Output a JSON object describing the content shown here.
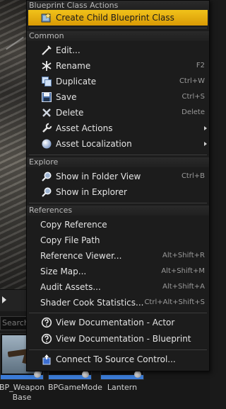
{
  "sections": [
    {
      "header": "Blueprint Class Actions",
      "items": [
        {
          "label": "Create Child Blueprint Class",
          "shortcut": "",
          "icon": "create-child-blueprint-icon",
          "highlighted": true
        }
      ]
    },
    {
      "header": "Common",
      "items": [
        {
          "label": "Edit...",
          "shortcut": "",
          "icon": "edit-icon"
        },
        {
          "label": "Rename",
          "shortcut": "F2",
          "icon": "rename-icon"
        },
        {
          "label": "Duplicate",
          "shortcut": "Ctrl+W",
          "icon": "duplicate-icon"
        },
        {
          "label": "Save",
          "shortcut": "Ctrl+S",
          "icon": "save-icon"
        },
        {
          "label": "Delete",
          "shortcut": "Delete",
          "icon": "delete-icon"
        },
        {
          "label": "Asset Actions",
          "shortcut": "",
          "icon": "wrench-icon",
          "submenu": true
        },
        {
          "label": "Asset Localization",
          "shortcut": "",
          "icon": "globe-icon",
          "submenu": true
        }
      ]
    },
    {
      "header": "Explore",
      "items": [
        {
          "label": "Show in Folder View",
          "shortcut": "Ctrl+B",
          "icon": "magnifier-icon"
        },
        {
          "label": "Show in Explorer",
          "shortcut": "",
          "icon": "magnifier-icon"
        }
      ]
    },
    {
      "header": "References",
      "items": [
        {
          "label": "Copy Reference",
          "shortcut": ""
        },
        {
          "label": "Copy File Path",
          "shortcut": ""
        },
        {
          "label": "Reference Viewer...",
          "shortcut": "Alt+Shift+R"
        },
        {
          "label": "Size Map...",
          "shortcut": "Alt+Shift+M"
        },
        {
          "label": "Audit Assets...",
          "shortcut": "Alt+Shift+A"
        },
        {
          "label": "Shader Cook Statistics...",
          "shortcut": "Ctrl+Alt+Shift+S"
        },
        {
          "label": "View Documentation - Actor",
          "shortcut": "",
          "icon": "help-icon"
        },
        {
          "label": "View Documentation - Blueprint",
          "shortcut": "",
          "icon": "help-icon"
        },
        {
          "label": "Connect To Source Control...",
          "shortcut": "",
          "icon": "source-control-icon"
        }
      ]
    }
  ],
  "background": {
    "search_placeholder": "Search",
    "assets": [
      {
        "label": "BP_Weapon Base"
      },
      {
        "label": "BPGameMode"
      },
      {
        "label": "Lantern"
      }
    ]
  },
  "colors": {
    "highlight": "#e6a80f",
    "menu_bg": "#1c1c1c",
    "text": "#e4e4e4",
    "shortcut_text": "#9a9a9a"
  }
}
